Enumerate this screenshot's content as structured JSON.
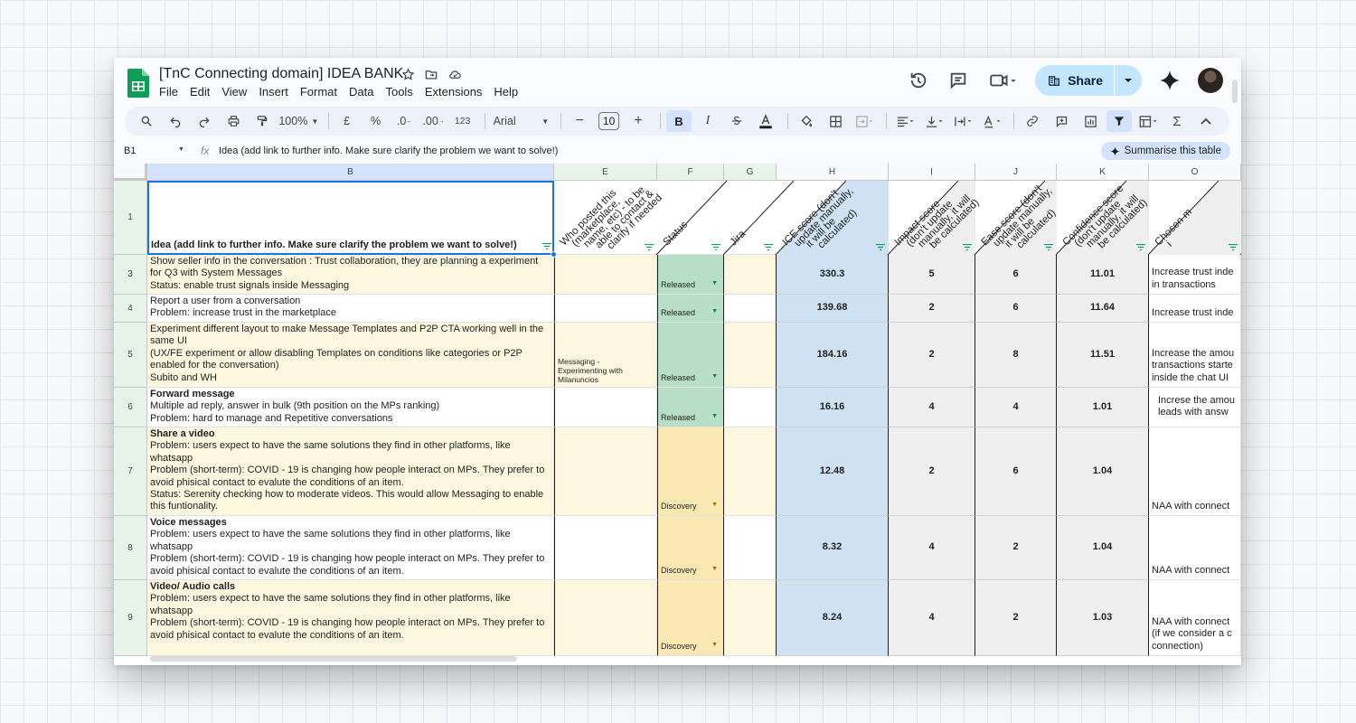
{
  "doc": {
    "title": "[TnC Connecting domain] IDEA BANK",
    "menu": [
      "File",
      "Edit",
      "View",
      "Insert",
      "Format",
      "Data",
      "Tools",
      "Extensions",
      "Help"
    ],
    "share_label": "Share"
  },
  "toolbar": {
    "zoom": "100%",
    "currency": "£",
    "percent": "%",
    "dec_decrease": ".0",
    "dec_increase": ".00",
    "format_123": "123",
    "font": "Arial",
    "font_size": "10",
    "bold": "B",
    "italic": "I",
    "sigma": "Σ"
  },
  "formula_bar": {
    "cell_ref": "B1",
    "fx": "fx",
    "content": "Idea (add link to further info. Make sure clarify the problem we want to solve!)",
    "summarise_label": "Summarise this table"
  },
  "columns": [
    {
      "letter": "B"
    },
    {
      "letter": "E"
    },
    {
      "letter": "F"
    },
    {
      "letter": "G"
    },
    {
      "letter": "H"
    },
    {
      "letter": "I"
    },
    {
      "letter": "J"
    },
    {
      "letter": "K"
    },
    {
      "letter": "O"
    }
  ],
  "header_row": {
    "row_number": "1",
    "idea": "Idea (add link to further info. Make sure clarify the problem we want to solve!)",
    "who_lines": [
      "Who posted this",
      "(marketplace,",
      "name, etc) - to be",
      "able to contact &",
      "clarify if needed"
    ],
    "status": "Status",
    "jira": "Jira",
    "ice_lines": [
      "ICE score (don't",
      "update manually,",
      "it will be",
      "calculated)"
    ],
    "impact_lines": [
      "Impact score",
      "(don't update",
      "manually, it will",
      "be calculated)"
    ],
    "ease_lines": [
      "Ease score (don't",
      "update manually,",
      "it will be",
      "calculated)"
    ],
    "confidence_lines": [
      "Confidence score",
      "(don't update",
      "manually, it will",
      "be calculated)"
    ],
    "chosen_lines": [
      "Chosen m",
      "i"
    ]
  },
  "rows": [
    {
      "num": "3",
      "title": "",
      "lines": [
        "Show seller info in the conversation : Trust collaboration, they are planning a experiment",
        "for Q3 with System Messages",
        "Status: enable trust signals inside Messaging"
      ],
      "who": "",
      "status": "Released",
      "ice": "330.3",
      "impact": "5",
      "ease": "6",
      "confidence": "11.01",
      "chosen": "Increase trust inde\nin transactions"
    },
    {
      "num": "4",
      "title": "",
      "lines": [
        "Report a user from a conversation",
        "Problem: increase trust in the marketplace"
      ],
      "who": "",
      "status": "Released",
      "ice": "139.68",
      "impact": "2",
      "ease": "6",
      "confidence": "11.64",
      "chosen": "Increase trust inde"
    },
    {
      "num": "5",
      "title": "",
      "lines": [
        "Experiment different layout to make Message Templates and P2P CTA working well in the",
        "same UI",
        "(UX/FE experiment or allow disabling Templates on conditions like categories or P2P",
        "enabled for the conversation)",
        "Subito and WH"
      ],
      "who": "Messaging -\nExperimenting with\nMilanuncios",
      "status": "Released",
      "ice": "184.16",
      "impact": "2",
      "ease": "8",
      "confidence": "11.51",
      "chosen": "Increase the amou\ntransactions starte\ninside the chat UI"
    },
    {
      "num": "6",
      "title": "Forward message",
      "lines": [
        "Multiple ad reply, answer in bulk (9th position on the MPs ranking)",
        "Problem: hard to manage and Repetitive conversations"
      ],
      "who": "",
      "status": "Released",
      "ice": "16.16",
      "impact": "4",
      "ease": "4",
      "confidence": "1.01",
      "chosen": "Increse the amou\nleads with answ"
    },
    {
      "num": "7",
      "title": "Share a video",
      "lines": [
        "Problem: users expect to have the same solutions they find in other platforms, like",
        "whatsapp",
        "Problem (short-term): COVID - 19 is changing how people interact on MPs. They prefer to",
        "avoid phisical contact to evalute the conditions of an item.",
        "Status: Serenity checking how to moderate videos. This would allow Messaging to enable",
        "this funtionality."
      ],
      "who": "",
      "status": "Discovery",
      "ice": "12.48",
      "impact": "2",
      "ease": "6",
      "confidence": "1.04",
      "chosen": "NAA with connect"
    },
    {
      "num": "8",
      "title": "Voice messages",
      "lines": [
        "Problem: users expect to have the same solutions they find in other platforms, like",
        "whatsapp",
        "Problem (short-term): COVID - 19 is changing how people interact on MPs. They prefer to",
        "avoid phisical contact to evalute the conditions of an item."
      ],
      "who": "",
      "status": "Discovery",
      "ice": "8.32",
      "impact": "4",
      "ease": "2",
      "confidence": "1.04",
      "chosen": "NAA with connect"
    },
    {
      "num": "9",
      "title": "Video/ Audio calls",
      "lines": [
        "Problem: users expect to have the same solutions they find in other platforms, like",
        "whatsapp",
        "Problem (short-term): COVID - 19 is changing how people interact on MPs. They prefer to",
        "avoid phisical contact to evalute the conditions of an item."
      ],
      "who": "",
      "status": "Discovery",
      "ice": "8.24",
      "impact": "4",
      "ease": "2",
      "confidence": "1.03",
      "chosen": "NAA with connect\n(if we consider a c\nconnection)"
    }
  ],
  "colors": {
    "released": "#b7dfc5",
    "discovery": "#fce8b2",
    "ice_col": "#cfe2f3",
    "grey_col": "#efefef",
    "idea_alt": "#fef7e0",
    "who_alt": "#fef7e0"
  }
}
